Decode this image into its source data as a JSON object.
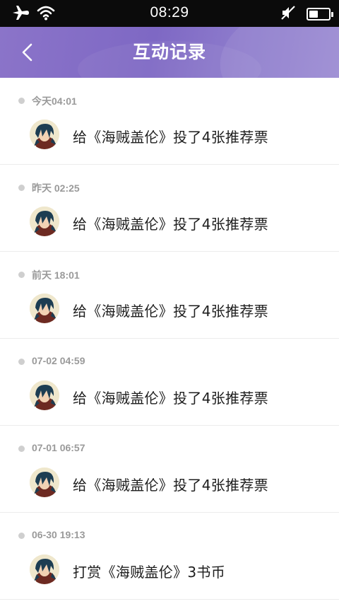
{
  "status_bar": {
    "time": "08:29",
    "battery_level": 0.45,
    "icons": [
      "airplane-mode-icon",
      "wifi-icon",
      "mute-icon",
      "battery-icon"
    ]
  },
  "header": {
    "title": "互动记录",
    "back_icon": "chevron-left-icon"
  },
  "records": [
    {
      "time": "今天04:01",
      "text": "给《海贼盖伦》投了4张推荐票"
    },
    {
      "time": "昨天 02:25",
      "text": "给《海贼盖伦》投了4张推荐票"
    },
    {
      "time": "前天 18:01",
      "text": "给《海贼盖伦》投了4张推荐票"
    },
    {
      "time": "07-02 04:59",
      "text": "给《海贼盖伦》投了4张推荐票"
    },
    {
      "time": "07-01 06:57",
      "text": "给《海贼盖伦》投了4张推荐票"
    },
    {
      "time": "06-30 19:13",
      "text": "打赏《海贼盖伦》3书币"
    }
  ],
  "colors": {
    "header": "#8070c6",
    "status_bar": "#0b0b0b",
    "time_text": "#9a9a9a",
    "dot": "#cfcfcf"
  }
}
